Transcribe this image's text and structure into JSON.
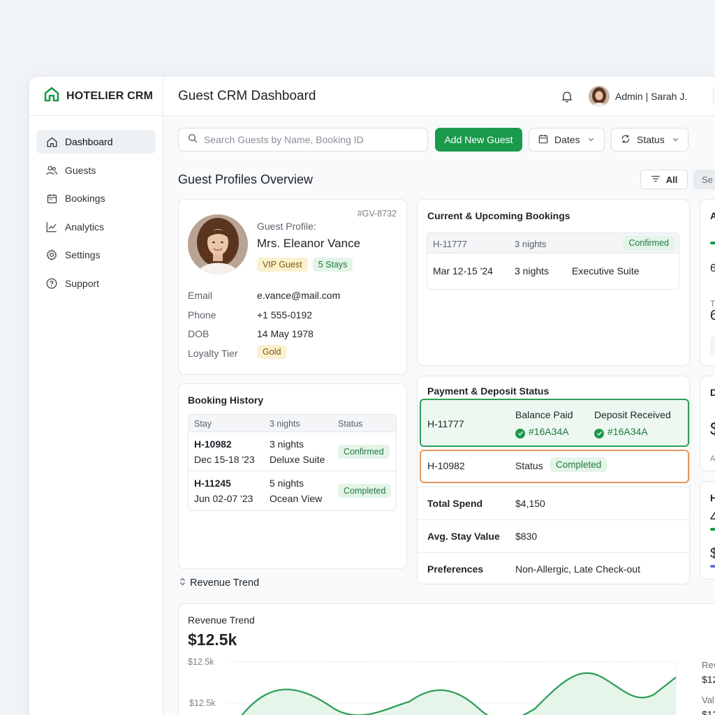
{
  "brand": {
    "name": "HOTELIER CRM"
  },
  "sidebar": {
    "items": [
      {
        "label": "Dashboard",
        "icon": "home-icon",
        "active": true
      },
      {
        "label": "Guests",
        "icon": "users-icon"
      },
      {
        "label": "Bookings",
        "icon": "calendar-icon"
      },
      {
        "label": "Analytics",
        "icon": "chart-line-icon"
      },
      {
        "label": "Settings",
        "icon": "gear-icon"
      },
      {
        "label": "Support",
        "icon": "help-circle-icon"
      }
    ]
  },
  "header": {
    "title": "Guest CRM Dashboard",
    "user": "Admin | Sarah J."
  },
  "toolbar": {
    "search_placeholder": "Search Guests by Name, Booking ID",
    "add_label": "Add New Guest",
    "dates_label": "Dates",
    "status_label": "Status"
  },
  "overview": {
    "title": "Guest Profiles Overview",
    "filter_all": "All",
    "filter_partial": "Se"
  },
  "profile": {
    "id": "#GV-8732",
    "caption": "Guest Profile:",
    "name": "Mrs. Eleanor Vance",
    "badges": [
      "VIP Guest",
      "5 Stays"
    ],
    "fields": [
      {
        "key": "Email",
        "value": "e.vance@mail.com"
      },
      {
        "key": "Phone",
        "value": "+1 555-0192"
      },
      {
        "key": "DOB",
        "value": "14 May 1978"
      },
      {
        "key": "Loyalty Tier",
        "value": "Gold"
      }
    ]
  },
  "current_bookings": {
    "title": "Current & Upcoming Bookings",
    "head": {
      "id": "H-11777",
      "nights": "3 nights",
      "status": "Confirmed"
    },
    "row": {
      "dates": "Mar 12-15 '24",
      "nights": "3 nights",
      "room": "Executive Suite"
    }
  },
  "booking_history": {
    "title": "Booking History",
    "columns": [
      "Stay",
      "3 nights",
      "Status"
    ],
    "rows": [
      {
        "id": "H-10982",
        "dates": "Dec 15-18 '23",
        "nights": "3 nights",
        "room": "Deluxe Suite",
        "status": "Confirmed"
      },
      {
        "id": "H-11245",
        "dates": "Jun 02-07 '23",
        "nights": "5 nights",
        "room": "Ocean View",
        "status": "Completed"
      }
    ]
  },
  "payment": {
    "title": "Payment & Deposit Status",
    "highlight": {
      "id": "H-11777",
      "balance_label": "Balance Paid",
      "balance_value": "#16A34A",
      "deposit_label": "Deposit Received",
      "deposit_value": "#16A34A"
    },
    "status_row": {
      "id": "H-10982",
      "label": "Status",
      "value": "Completed"
    },
    "rows": [
      {
        "label": "Total Spend",
        "value": "$4,150"
      },
      {
        "label": "Avg. Stay Value",
        "value": "$830"
      },
      {
        "label": "Preferences",
        "value": "Non-Allergic, Late Check-out"
      }
    ]
  },
  "side_cards": {
    "a": {
      "initial": "A",
      "t": "T",
      "d1": "6",
      "d2": "6"
    },
    "d": {
      "initial": "D",
      "amount": "$",
      "sub": "A"
    },
    "h": {
      "initial": "H",
      "d1": "4",
      "d2": "$"
    }
  },
  "revenue_toggle": {
    "label": "Revenue Trend"
  },
  "revenue": {
    "title": "Revenue Trend",
    "total": "$12.5k",
    "y_labels": [
      "$12.5k",
      "$12.5k"
    ],
    "legend": [
      {
        "label": "Rev",
        "value": "$12"
      },
      {
        "label": "Val",
        "value": "$12"
      }
    ]
  },
  "colors": {
    "accent": "#1a9a4b",
    "highlight_border": "#2f9e57",
    "warning_border": "#e8955a"
  }
}
